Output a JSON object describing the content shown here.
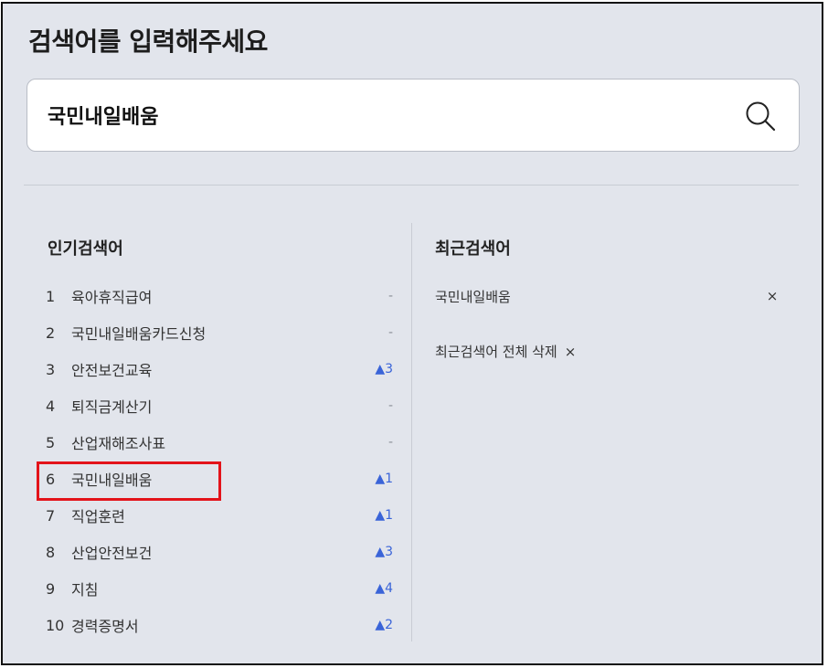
{
  "title": "검색어를 입력해주세요",
  "search": {
    "value": "국민내일배움",
    "icon": "search-icon"
  },
  "popular": {
    "heading": "인기검색어",
    "items": [
      {
        "rank": "1",
        "keyword": "육아휴직급여",
        "change": "-",
        "up": false
      },
      {
        "rank": "2",
        "keyword": "국민내일배움카드신청",
        "change": "-",
        "up": false
      },
      {
        "rank": "3",
        "keyword": "안전보건교육",
        "change": "▲3",
        "up": true
      },
      {
        "rank": "4",
        "keyword": "퇴직금계산기",
        "change": "-",
        "up": false
      },
      {
        "rank": "5",
        "keyword": "산업재해조사표",
        "change": "-",
        "up": false
      },
      {
        "rank": "6",
        "keyword": "국민내일배움",
        "change": "▲1",
        "up": true
      },
      {
        "rank": "7",
        "keyword": "직업훈련",
        "change": "▲1",
        "up": true
      },
      {
        "rank": "8",
        "keyword": "산업안전보건",
        "change": "▲3",
        "up": true
      },
      {
        "rank": "9",
        "keyword": "지침",
        "change": "▲4",
        "up": true
      },
      {
        "rank": "10",
        "keyword": "경력증명서",
        "change": "▲2",
        "up": true
      }
    ]
  },
  "recent": {
    "heading": "최근검색어",
    "items": [
      {
        "keyword": "국민내일배움",
        "remove": "×"
      }
    ],
    "clear_all": "최근검색어 전체 삭제",
    "clear_all_x": "×"
  },
  "colors": {
    "up": "#3a64d8",
    "highlight": "#e3131a",
    "background": "#e2e5ec"
  }
}
